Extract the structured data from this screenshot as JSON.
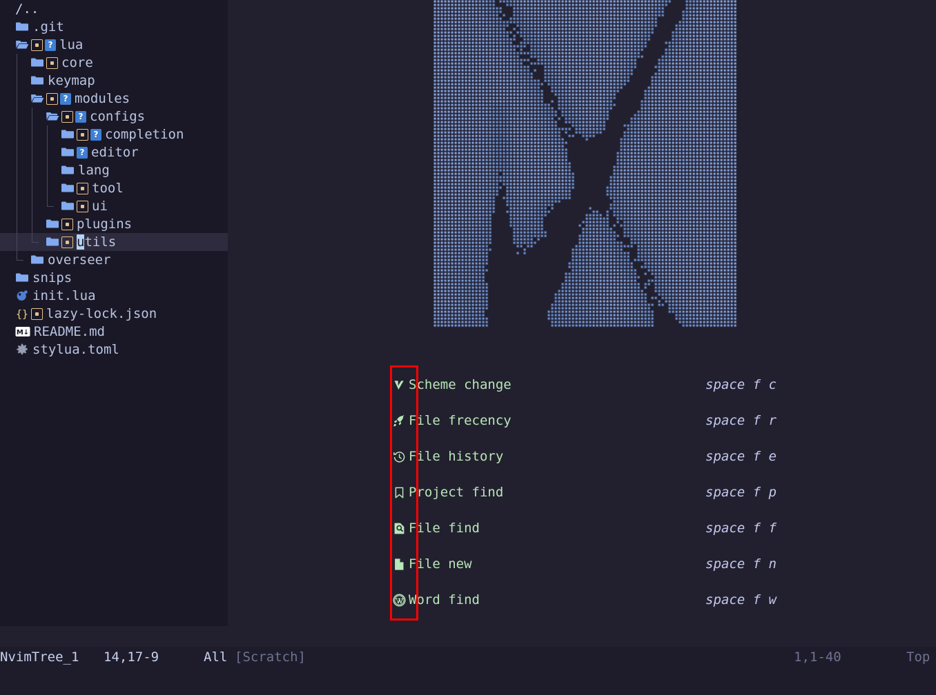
{
  "colors": {
    "bg_main": "#22202e",
    "bg_sidebar": "#1a1826",
    "bg_selected": "#2d2b3d",
    "statusline_bg": "#1e1c2a",
    "folder_blue": "#82aaf0",
    "menu_green": "#b8e6b8",
    "keybind_lavender": "#c3c8f0",
    "annotation_red": "#ff0000",
    "badge_orange": "#e8c08a",
    "badge_blue": "#3f7fd4",
    "ascii_dot": "#6aa4e8",
    "tree_text": "#b9c4e3"
  },
  "sidebar": {
    "root": "/..",
    "items": [
      {
        "label": ".git",
        "indent": 0,
        "icon": "folder-closed-icon",
        "open": false,
        "modified": false,
        "untracked": false,
        "guides": []
      },
      {
        "label": "lua",
        "indent": 0,
        "icon": "folder-open-icon",
        "open": true,
        "modified": true,
        "untracked": true,
        "guides": []
      },
      {
        "label": "core",
        "indent": 1,
        "icon": "folder-closed-icon",
        "open": false,
        "modified": true,
        "untracked": false,
        "guides": [
          0
        ]
      },
      {
        "label": "keymap",
        "indent": 1,
        "icon": "folder-closed-icon",
        "open": false,
        "modified": false,
        "untracked": false,
        "guides": [
          0
        ]
      },
      {
        "label": "modules",
        "indent": 1,
        "icon": "folder-open-icon",
        "open": true,
        "modified": true,
        "untracked": true,
        "guides": [
          0
        ]
      },
      {
        "label": "configs",
        "indent": 2,
        "icon": "folder-open-icon",
        "open": true,
        "modified": true,
        "untracked": true,
        "guides": [
          0,
          1
        ]
      },
      {
        "label": "completion",
        "indent": 3,
        "icon": "folder-closed-icon",
        "open": false,
        "modified": true,
        "untracked": true,
        "guides": [
          0,
          1,
          2
        ]
      },
      {
        "label": "editor",
        "indent": 3,
        "icon": "folder-closed-icon",
        "open": false,
        "modified": false,
        "untracked": true,
        "guides": [
          0,
          1,
          2
        ]
      },
      {
        "label": "lang",
        "indent": 3,
        "icon": "folder-closed-icon",
        "open": false,
        "modified": false,
        "untracked": false,
        "guides": [
          0,
          1,
          2
        ]
      },
      {
        "label": "tool",
        "indent": 3,
        "icon": "folder-closed-icon",
        "open": false,
        "modified": true,
        "untracked": false,
        "guides": [
          0,
          1,
          2
        ]
      },
      {
        "label": "ui",
        "indent": 3,
        "icon": "folder-closed-icon",
        "open": false,
        "modified": true,
        "untracked": false,
        "guides": [
          0,
          1
        ],
        "last": true
      },
      {
        "label": "plugins",
        "indent": 2,
        "icon": "folder-closed-icon",
        "open": false,
        "modified": true,
        "untracked": false,
        "guides": [
          0,
          1
        ]
      },
      {
        "label": "utils",
        "indent": 2,
        "icon": "folder-closed-icon",
        "open": false,
        "modified": true,
        "untracked": false,
        "guides": [
          0
        ],
        "last": true,
        "selected": true,
        "cursor": 0
      },
      {
        "label": "overseer",
        "indent": 1,
        "icon": "folder-closed-icon",
        "open": false,
        "modified": false,
        "untracked": false,
        "guides": [],
        "last": true
      },
      {
        "label": "snips",
        "indent": 0,
        "icon": "folder-closed-icon",
        "open": false,
        "modified": false,
        "untracked": false,
        "guides": []
      },
      {
        "label": "init.lua",
        "indent": 0,
        "icon": "lua-file-icon",
        "open": false,
        "modified": false,
        "untracked": false,
        "guides": []
      },
      {
        "label": "lazy-lock.json",
        "indent": 0,
        "icon": "json-file-icon",
        "open": false,
        "modified": true,
        "untracked": false,
        "guides": []
      },
      {
        "label": "README.md",
        "indent": 0,
        "icon": "markdown-file-icon",
        "open": false,
        "modified": false,
        "untracked": false,
        "guides": []
      },
      {
        "label": "stylua.toml",
        "indent": 0,
        "icon": "gear-file-icon",
        "open": false,
        "modified": false,
        "untracked": false,
        "guides": []
      }
    ]
  },
  "dashboard": {
    "menu": [
      {
        "icon": "checkmark-icon",
        "label": "Scheme change",
        "key": "space f c"
      },
      {
        "icon": "rocket-icon",
        "label": "File frecency",
        "key": "space f r"
      },
      {
        "icon": "clock-history-icon",
        "label": "File history",
        "key": "space f e"
      },
      {
        "icon": "bookmark-icon",
        "label": "Project find",
        "key": "space f p"
      },
      {
        "icon": "file-search-icon",
        "label": "File find",
        "key": "space f f"
      },
      {
        "icon": "new-file-icon",
        "label": "File new",
        "key": "space f n"
      },
      {
        "icon": "wordpress-icon",
        "label": "Word find",
        "key": "space f w"
      }
    ]
  },
  "statusline": {
    "buffer_name": "NvimTree_1",
    "cursor_pos": "14,17-9",
    "scroll_pct": "All",
    "scratch_label": "[Scratch]",
    "right_cursor_pos": "1,1-40",
    "right_scroll_pct": "Top"
  }
}
